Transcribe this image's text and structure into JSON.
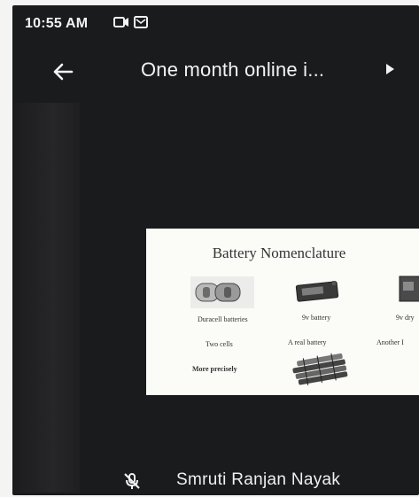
{
  "status_bar": {
    "time": "10:55 AM",
    "icons": [
      "video-camera-icon",
      "mail-icon"
    ]
  },
  "top_bar": {
    "back_icon": "arrow-left-icon",
    "title": "One month online i...",
    "play_icon": "play-triangle-icon"
  },
  "slide": {
    "title": "Battery Nomenclature",
    "items": [
      "Duracell batteries",
      "9v battery",
      "9v dry",
      "Two cells",
      "A real battery",
      "Another I",
      "More precisely"
    ]
  },
  "bottom_bar": {
    "mic_icon": "microphone-off-icon",
    "speaker_name": "Smruti Ranjan Nayak"
  },
  "colors": {
    "screen_bg": "#1a1b1d",
    "text": "#f3f3f3",
    "slide_bg": "#fbfbf8"
  }
}
